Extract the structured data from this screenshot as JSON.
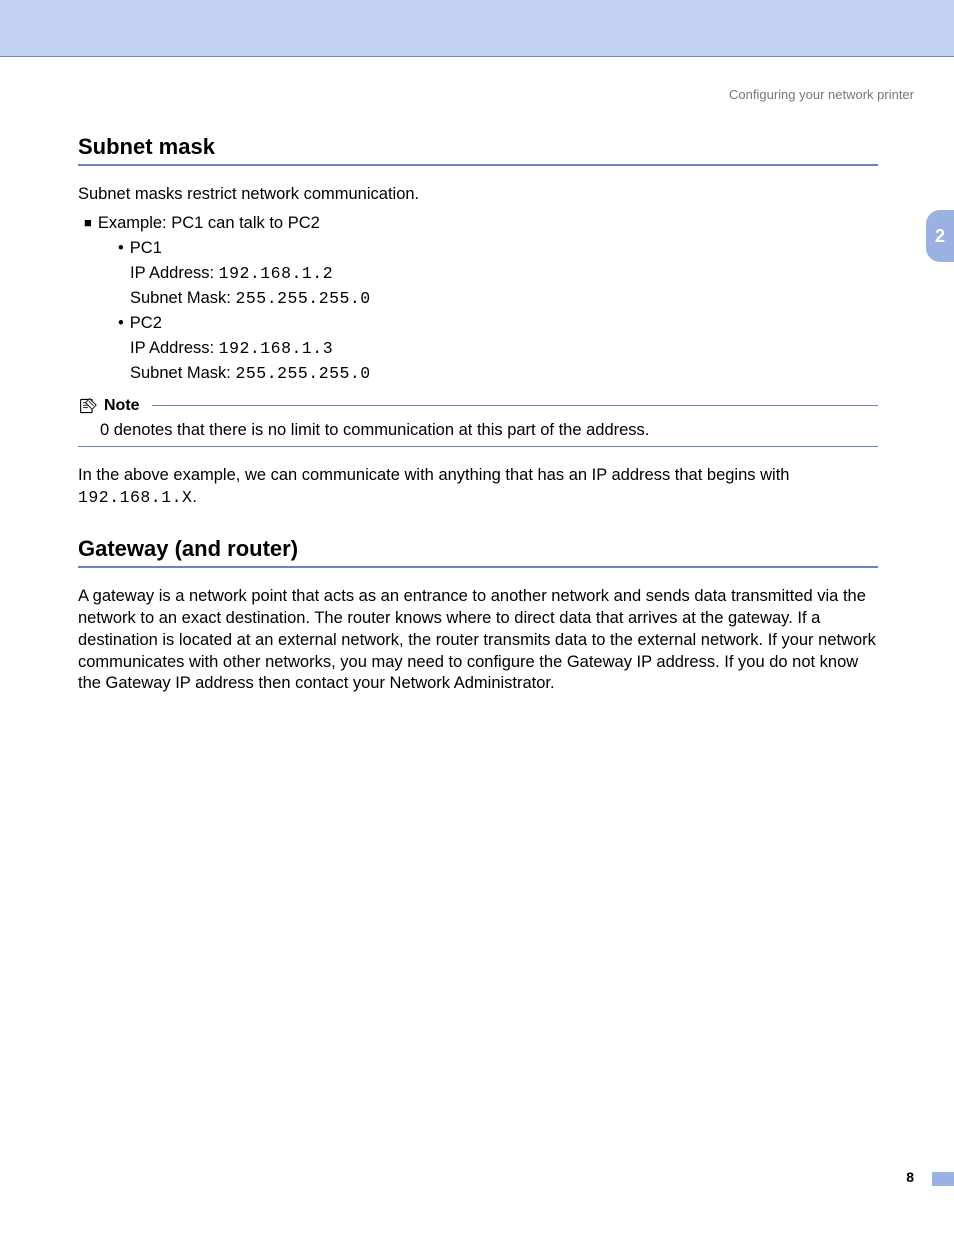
{
  "breadcrumb": "Configuring your network printer",
  "chapter_tab": "2",
  "page_number": "8",
  "section1": {
    "title": "Subnet mask",
    "intro": "Subnet masks restrict network communication.",
    "example_label": "Example: PC1 can talk to PC2",
    "pc1": {
      "name": "PC1",
      "ip_label": "IP Address: ",
      "ip_value": "192.168.1.2",
      "mask_label": "Subnet Mask: ",
      "mask_value": "255.255.255.0"
    },
    "pc2": {
      "name": "PC2",
      "ip_label": "IP Address: ",
      "ip_value": "192.168.1.3",
      "mask_label": "Subnet Mask: ",
      "mask_value": "255.255.255.0"
    },
    "note_label": "Note",
    "note_body": "0 denotes that there is no limit to communication at this part of the address.",
    "after_note_prefix": "In the above example, we can communicate with anything that has an IP address that begins with ",
    "after_note_mono": "192.168.1.X",
    "after_note_suffix": "."
  },
  "section2": {
    "title": "Gateway (and router)",
    "body": "A gateway is a network point that acts as an entrance to another network and sends data transmitted via the network to an exact destination. The router knows where to direct data that arrives at the gateway. If a destination is located at an external network, the router transmits data to the external network. If your network communicates with other networks, you may need to configure the Gateway IP address. If you do not know the Gateway IP address then contact your Network Administrator."
  }
}
